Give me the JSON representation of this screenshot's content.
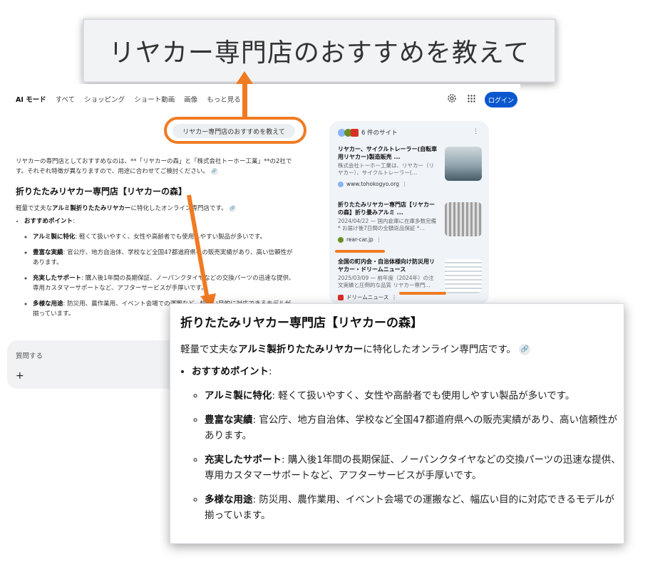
{
  "banner": {
    "query_zoom": "リヤカー専門店のおすすめを教えて"
  },
  "nav": {
    "tabs": [
      "AI モード",
      "すべて",
      "ショッピング",
      "ショート動画",
      "画像",
      "もっと見る ▾"
    ],
    "login_label": "ログイン"
  },
  "query_chip": "リヤカー専門店のおすすめを教えて",
  "answer": {
    "intro": "リヤカーの専門店としておすすめなのは、**「リヤカーの森」と「株式会社トーホー工業」**の2社です。それぞれ特徴が異なりますので、用途に合わせてご検討ください。",
    "heading": "折りたたみリヤカー専門店【リヤカーの森】",
    "desc_pre": "軽量で丈夫な",
    "desc_bold": "アルミ製折りたたみリヤカー",
    "desc_post": "に特化したオンライン専門店です。",
    "points_label": "おすすめポイント",
    "points": [
      {
        "bold": "アルミ製に特化",
        "text": ": 軽くて扱いやすく、女性や高齢者でも使用しやすい製品が多いです。"
      },
      {
        "bold": "豊富な実績",
        "text": ": 官公庁、地方自治体、学校など全国47都道府県への販売実績があり、高い信頼性があります。"
      },
      {
        "bold": "充実したサポート",
        "text": ": 購入後1年間の長期保証、ノーパンクタイヤなどの交換パーツの迅速な提供、専用カスタマーサポートなど、アフターサービスが手厚いです。"
      },
      {
        "bold": "多様な用途",
        "text": ": 防災用、農作業用、イベント会場での運搬など、幅広い目的に対応できるモデルが揃っています。"
      }
    ]
  },
  "ask": {
    "placeholder": "質問する",
    "plus": "+"
  },
  "sources": {
    "header": "6 件のサイト",
    "items": [
      {
        "title": "リヤカー、サイクルトレーラー(自転車用リヤカー)製造販売 ...",
        "snippet": "株式会社トーホー工業は、リヤカー（リヤカー）、サイクルトレーラー(…",
        "site": "www.tohokogyo.org"
      },
      {
        "title": "折りたたみリヤカー専門店【リヤカーの森】折り畳みアルミ ...",
        "snippet": "2024/04/22 — 国内倉庫に在庫多数完備 * お届け後7日間の全額返品保証 *…",
        "site": "rear-car.jp"
      },
      {
        "title": "全国の町内会・自治体様向け防災用リヤカー・ドリームニュース",
        "snippet": "2025/03/09 — 前年度（2024年）の注文実績と圧倒的な品質 リヤカー専門…",
        "site": "ドリームニュース"
      }
    ]
  },
  "colors": {
    "accent": "#f07b22",
    "login": "#0b57d0"
  }
}
